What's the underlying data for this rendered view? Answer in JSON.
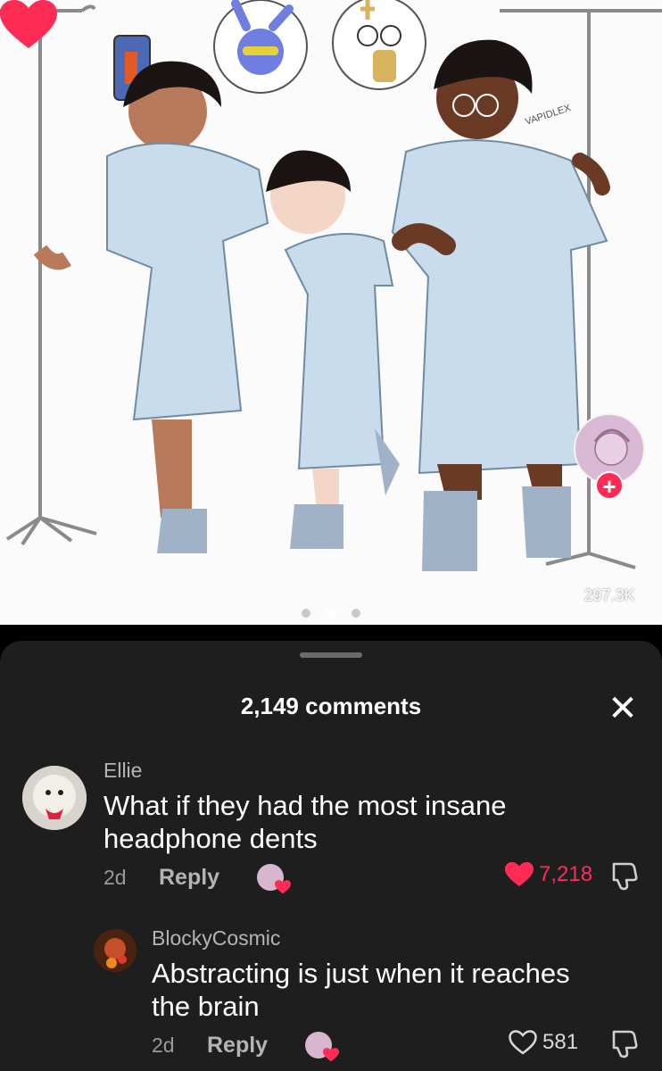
{
  "artwork": {
    "signature": "VAPIDLEX",
    "like_count": "297.3K",
    "carousel_total": 3,
    "carousel_active": 2
  },
  "comments_sheet": {
    "title": "2,149 comments",
    "close_glyph": "✕",
    "comments": [
      {
        "username": "Ellie",
        "text": "What if they had the most insane headphone dents",
        "time": "2d",
        "reply_label": "Reply",
        "likes": "7,218",
        "liked": true
      },
      {
        "username": "BlockyCosmic",
        "text": "Abstracting is just when it reaches the brain",
        "time": "2d",
        "reply_label": "Reply",
        "likes": "581",
        "liked": false
      }
    ]
  },
  "colors": {
    "accent": "#fe2c55",
    "sheet_bg": "#1e1e1e",
    "gown": "#c9dcec"
  }
}
